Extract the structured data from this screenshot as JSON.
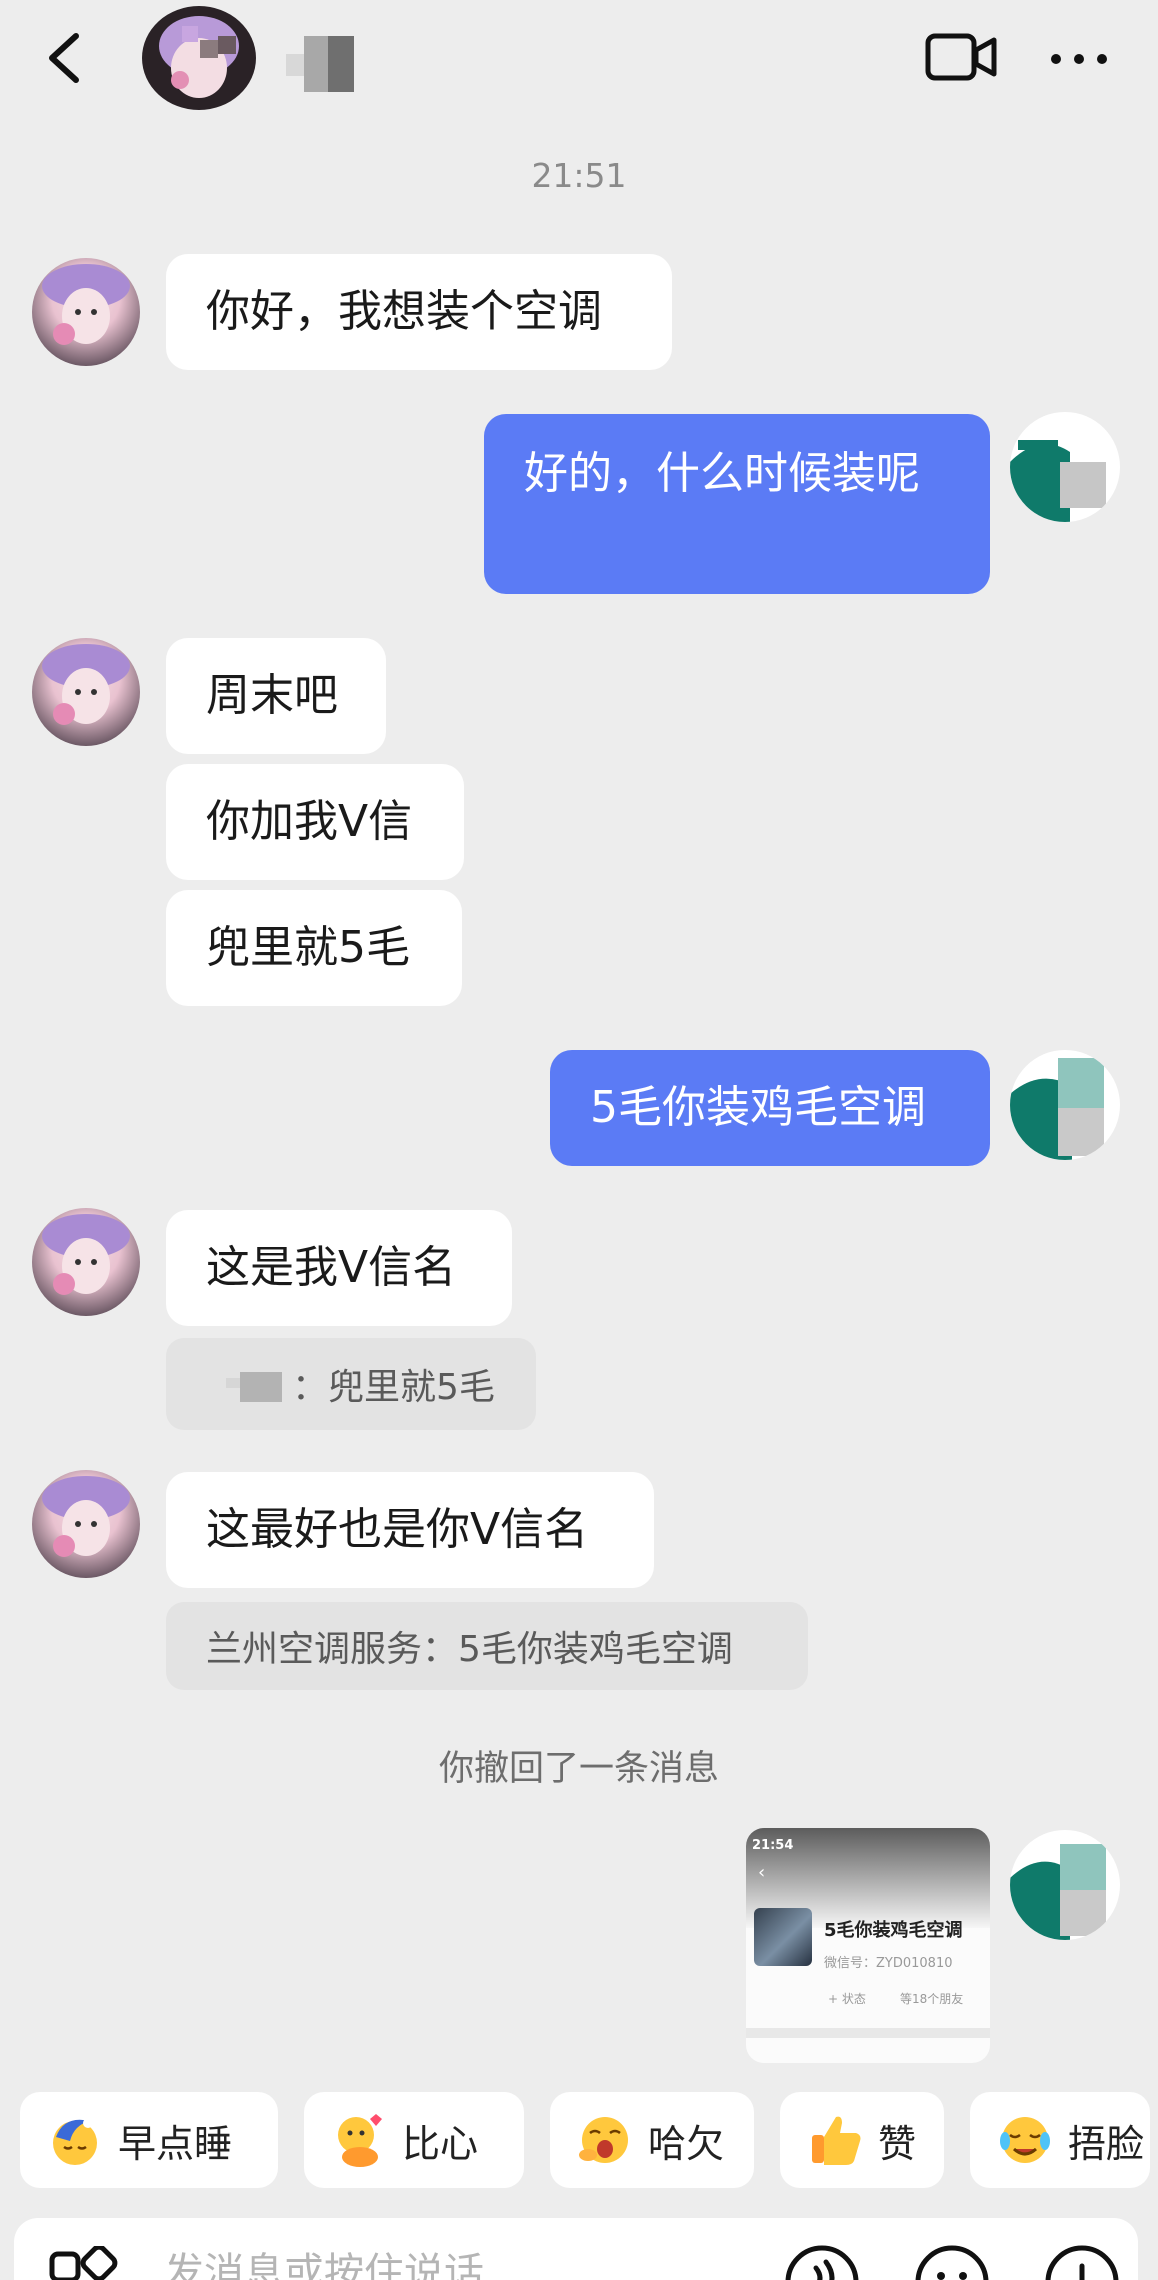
{
  "header": {
    "back_label": "back",
    "more_label": "more"
  },
  "chat": {
    "time": "21:51",
    "messages": [
      {
        "text": "你好，我想装个空调"
      },
      {
        "text": "好的，什么时候装呢"
      },
      {
        "text": "周末吧"
      },
      {
        "text": "你加我V信"
      },
      {
        "text": "兜里就5毛"
      },
      {
        "text": "5毛你装鸡毛空调"
      },
      {
        "text": "这是我V信名"
      },
      {
        "text": "：兜里就5毛"
      },
      {
        "text": "这最好也是你V信名"
      },
      {
        "text": "兰州空调服务：5毛你装鸡毛空调"
      }
    ],
    "recall": "你撤回了一条消息",
    "screenshot": {
      "time": "21:54",
      "title": "5毛你装鸡毛空调",
      "wechat_id": "微信号：ZYD010810",
      "status": "+ 状态",
      "friends": "等18个朋友"
    }
  },
  "quick_replies": [
    {
      "label": "早点睡",
      "icon": "sleepy-moon-emoji-icon"
    },
    {
      "label": "比心",
      "icon": "finger-heart-emoji-icon"
    },
    {
      "label": "哈欠",
      "icon": "yawn-emoji-icon"
    },
    {
      "label": "赞",
      "icon": "thumbs-up-emoji-icon"
    },
    {
      "label": "捂脸",
      "icon": "facepalm-emoji-icon"
    }
  ],
  "input": {
    "placeholder": "发消息或按住说话"
  },
  "colors": {
    "background": "#ededed",
    "outgoing_bubble": "#5b7bf5",
    "incoming_bubble": "#ffffff",
    "quote": "#e3e3e3"
  }
}
